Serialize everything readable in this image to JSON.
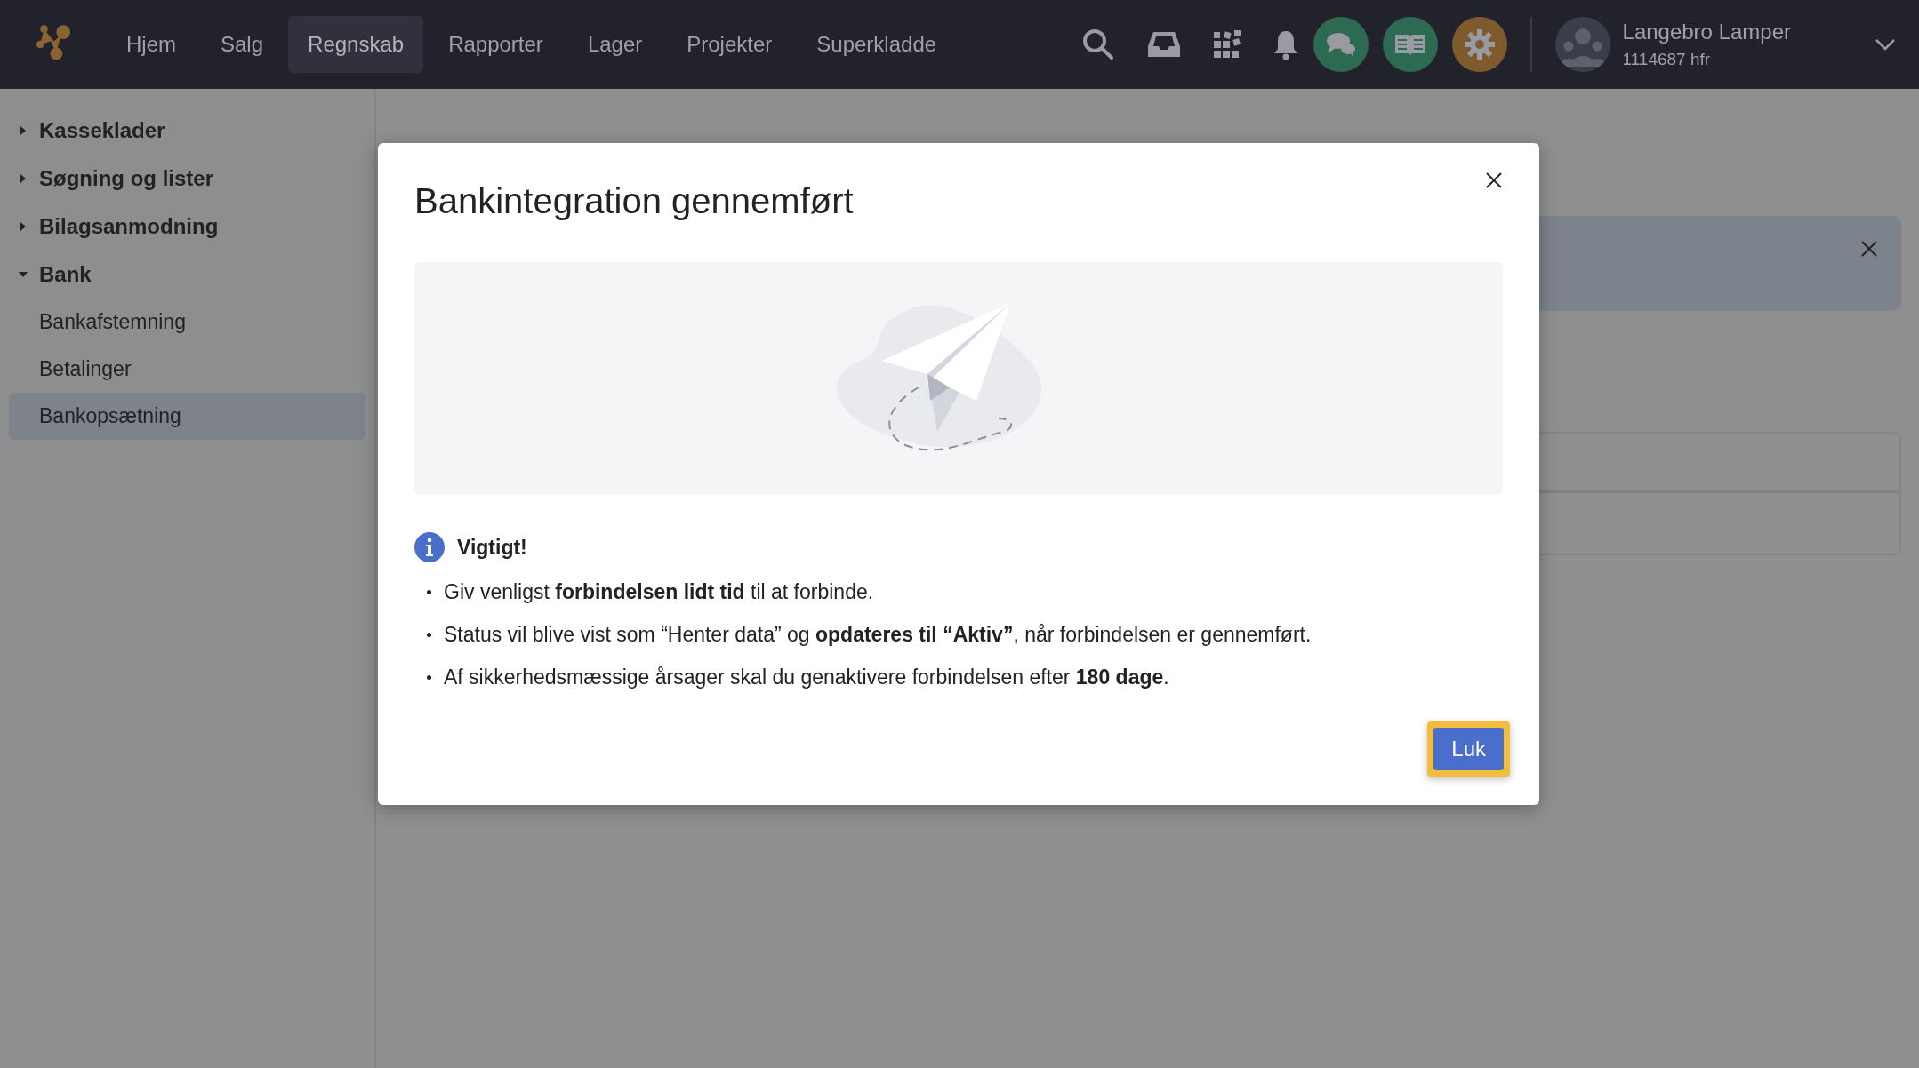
{
  "nav": {
    "items": [
      {
        "label": "Hjem",
        "selected": false
      },
      {
        "label": "Salg",
        "selected": false
      },
      {
        "label": "Regnskab",
        "selected": true
      },
      {
        "label": "Rapporter",
        "selected": false
      },
      {
        "label": "Lager",
        "selected": false
      },
      {
        "label": "Projekter",
        "selected": false
      },
      {
        "label": "Superkladde",
        "selected": false
      }
    ]
  },
  "user": {
    "name": "Langebro Lamper",
    "account": "1114687 hfr"
  },
  "sidebar": {
    "items": [
      {
        "label": "Kasseklader",
        "expanded": false
      },
      {
        "label": "Søgning og lister",
        "expanded": false
      },
      {
        "label": "Bilagsanmodning",
        "expanded": false
      },
      {
        "label": "Bank",
        "expanded": true,
        "children": [
          {
            "label": "Bankafstemning",
            "selected": false
          },
          {
            "label": "Betalinger",
            "selected": false
          },
          {
            "label": "Bankopsætning",
            "selected": true
          }
        ]
      }
    ]
  },
  "modal": {
    "title": "Bankintegration gennemført",
    "notice_heading": "Vigtigt!",
    "bullets": [
      "Giv venligst **forbindelsen lidt tid** til at forbinde.",
      "Status vil blive vist som “Henter data” og **opdateres til “Aktiv”**, når forbindelsen er gennemført.",
      "Af sikkerhedsmæssige årsager skal du genaktivere forbindelsen efter **180 dage**."
    ],
    "button": "Luk"
  }
}
